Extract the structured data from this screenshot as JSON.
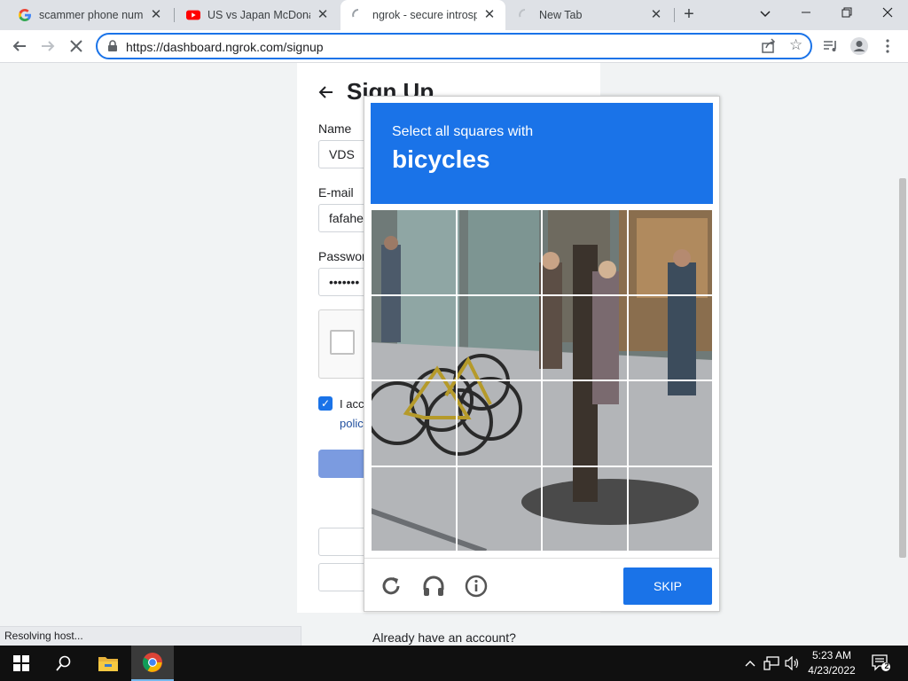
{
  "tabs": [
    {
      "title": "scammer phone numb",
      "favicon": "google-favicon-icon"
    },
    {
      "title": "US vs Japan McDonald",
      "favicon": "youtube-favicon-icon"
    },
    {
      "title": "ngrok - secure introsp",
      "favicon": "loading-spinner-icon",
      "active": true
    },
    {
      "title": "New Tab",
      "favicon": "loading-spinner-icon"
    }
  ],
  "toolbar": {
    "url": "https://dashboard.ngrok.com/signup"
  },
  "signup": {
    "title": "Sign Up",
    "name_label": "Name",
    "name_value": "VDS",
    "email_label": "E-mail",
    "email_value": "fafahe",
    "password_label": "Passwor",
    "password_value": "•••••••",
    "accept_text": "I acc",
    "policy_text": "polic",
    "already_text": "Already have an account?"
  },
  "recaptcha": {
    "instruction": "Select all squares with",
    "target": "bicycles",
    "skip_label": "SKIP",
    "rows": 4,
    "cols": 4
  },
  "status_bar": "Resolving host...",
  "taskbar": {
    "time": "5:23 AM",
    "date": "4/23/2022",
    "notification_count": "2"
  },
  "colors": {
    "accent": "#1a73e8",
    "submit_disabled": "#7b9be0"
  }
}
